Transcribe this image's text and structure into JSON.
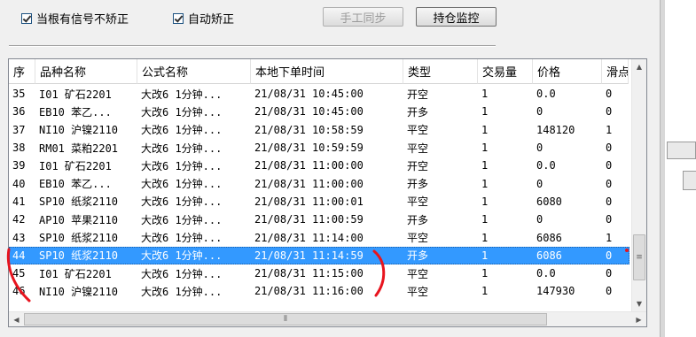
{
  "options": {
    "no_correct_when_signal": "当根有信号不矫正",
    "auto_correct": "自动矫正"
  },
  "buttons": {
    "manual_sync": "手工同步",
    "position_monitor": "持仓监控"
  },
  "table": {
    "columns": [
      "序",
      "品种名称",
      "公式名称",
      "本地下单时间",
      "类型",
      "交易量",
      "价格",
      "滑点"
    ],
    "selected_row_index": 9,
    "rows": [
      [
        "35",
        "I01 矿石2201",
        "大改6 1分钟...",
        "21/08/31 10:45:00",
        "开空",
        "1",
        "0.0",
        "0"
      ],
      [
        "36",
        "EB10 苯乙...",
        "大改6 1分钟...",
        "21/08/31 10:45:00",
        "开多",
        "1",
        "0",
        "0"
      ],
      [
        "37",
        "NI10 沪镍2110",
        "大改6 1分钟...",
        "21/08/31 10:58:59",
        "平空",
        "1",
        "148120",
        "1"
      ],
      [
        "38",
        "RM01 菜粕2201",
        "大改6 1分钟...",
        "21/08/31 10:59:59",
        "平空",
        "1",
        "0",
        "0"
      ],
      [
        "39",
        "I01 矿石2201",
        "大改6 1分钟...",
        "21/08/31 11:00:00",
        "开空",
        "1",
        "0.0",
        "0"
      ],
      [
        "40",
        "EB10 苯乙...",
        "大改6 1分钟...",
        "21/08/31 11:00:00",
        "开多",
        "1",
        "0",
        "0"
      ],
      [
        "41",
        "SP10 纸浆2110",
        "大改6 1分钟...",
        "21/08/31 11:00:01",
        "平空",
        "1",
        "6080",
        "0"
      ],
      [
        "42",
        "AP10 苹果2110",
        "大改6 1分钟...",
        "21/08/31 11:00:59",
        "开多",
        "1",
        "0",
        "0"
      ],
      [
        "43",
        "SP10 纸浆2110",
        "大改6 1分钟...",
        "21/08/31 11:14:00",
        "平空",
        "1",
        "6086",
        "1"
      ],
      [
        "44",
        "SP10 纸浆2110",
        "大改6 1分钟...",
        "21/08/31 11:14:59",
        "开多",
        "1",
        "6086",
        "0"
      ],
      [
        "45",
        "I01 矿石2201",
        "大改6 1分钟...",
        "21/08/31 11:15:00",
        "平空",
        "1",
        "0.0",
        "0"
      ],
      [
        "46",
        "NI10 沪镍2110",
        "大改6 1分钟...",
        "21/08/31 11:16:00",
        "平空",
        "1",
        "147930",
        "0"
      ]
    ]
  },
  "colors": {
    "selection": "#3399ff",
    "annotation": "#e8141e"
  }
}
